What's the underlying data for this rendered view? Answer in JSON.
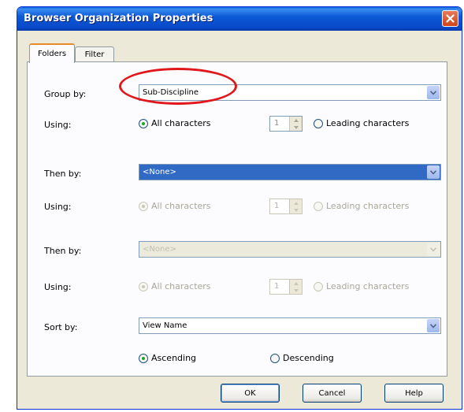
{
  "window": {
    "title": "Browser Organization Properties"
  },
  "tabs": [
    {
      "label": "Folders",
      "active": true
    },
    {
      "label": "Filter",
      "active": false
    }
  ],
  "group_by": {
    "label": "Group by:",
    "value": "Sub-Discipline",
    "using_label": "Using:",
    "all_chars": "All characters",
    "leading_chars": "Leading characters",
    "count": "1",
    "selected_option": "All characters"
  },
  "then_by_1": {
    "label": "Then by:",
    "value": "<None>",
    "using_label": "Using:",
    "all_chars": "All characters",
    "leading_chars": "Leading characters",
    "count": "1",
    "enabled": false
  },
  "then_by_2": {
    "label": "Then by:",
    "value": "<None>",
    "using_label": "Using:",
    "all_chars": "All characters",
    "leading_chars": "Leading characters",
    "count": "1",
    "enabled": false
  },
  "sort_by": {
    "label": "Sort by:",
    "value": "View Name",
    "ascending": "Ascending",
    "descending": "Descending",
    "selected_order": "Ascending"
  },
  "buttons": {
    "ok": "OK",
    "cancel": "Cancel",
    "help": "Help"
  },
  "colors": {
    "titlebar": "#0a5fd8",
    "highlight": "#316ac5",
    "annotation": "#e0181c"
  },
  "icons": {
    "close": "close-icon",
    "dropdown": "chevron-down-icon"
  }
}
